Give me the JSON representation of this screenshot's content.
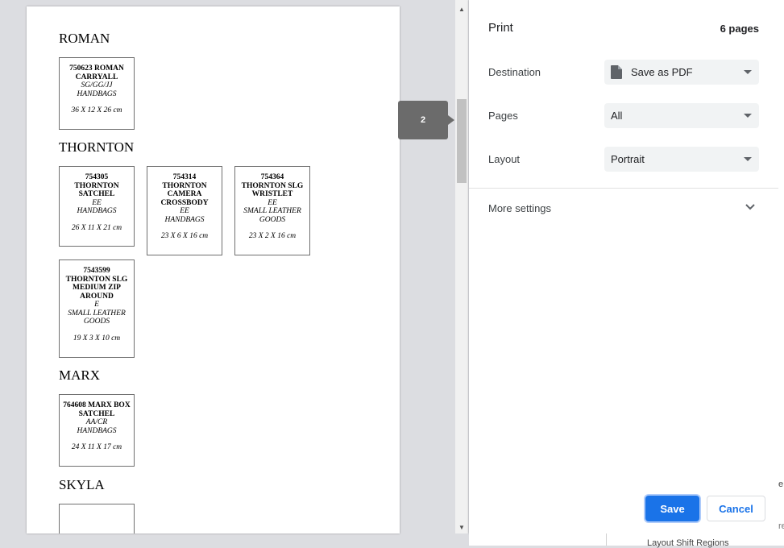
{
  "preview": {
    "tooltip_page": "2",
    "sections": [
      {
        "title": "ROMAN",
        "cards": [
          {
            "name": "750623 ROMAN CARRYALL",
            "code": "SG/GG/JJ",
            "category": "HANDBAGS",
            "dims": "36 X 12 X 26 cm"
          }
        ]
      },
      {
        "title": "THORNTON",
        "cards": [
          {
            "name": "754305 THORNTON SATCHEL",
            "code": "EE",
            "category": "HANDBAGS",
            "dims": "26 X 11 X 21 cm"
          },
          {
            "name": "754314 THORNTON CAMERA CROSSBODY",
            "code": "EE",
            "category": "HANDBAGS",
            "dims": "23 X 6 X 16 cm"
          },
          {
            "name": "754364 THORNTON SLG WRISTLET",
            "code": "EE",
            "category": "SMALL LEATHER GOODS",
            "dims": "23 X 2 X 16 cm"
          },
          {
            "name": "7543599 THORNTON SLG MEDIUM ZIP AROUND",
            "code": "E",
            "category": "SMALL LEATHER GOODS",
            "dims": "19 X 3 X 10 cm"
          }
        ]
      },
      {
        "title": "MARX",
        "cards": [
          {
            "name": "764608 MARX BOX SATCHEL",
            "code": "AA/CR",
            "category": "HANDBAGS",
            "dims": "24 X 11 X 17 cm"
          }
        ]
      },
      {
        "title": "SKYLA",
        "cards": []
      }
    ]
  },
  "panel": {
    "title": "Print",
    "page_count": "6 pages",
    "destination": {
      "label": "Destination",
      "value": "Save as PDF",
      "icon": "document-icon"
    },
    "pages": {
      "label": "Pages",
      "value": "All"
    },
    "layout": {
      "label": "Layout",
      "value": "Portrait"
    },
    "more_settings": "More settings",
    "save_label": "Save",
    "cancel_label": "Cancel"
  },
  "background": {
    "bottom_text": "Layout Shift Regions",
    "frag1": "e",
    "frag2": "re"
  },
  "colors": {
    "accent": "#1a73e8",
    "tooltip": "#6b6b6b"
  }
}
